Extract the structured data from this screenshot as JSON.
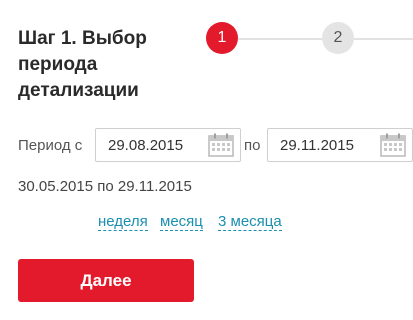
{
  "header": {
    "title": "Шаг 1. Выбор периода детализации"
  },
  "steps": [
    {
      "number": "1",
      "state": "active"
    },
    {
      "number": "2",
      "state": "inactive"
    }
  ],
  "period": {
    "label_from": "Период с",
    "date_from": "29.08.2015",
    "label_to": "по",
    "date_to": "29.11.2015"
  },
  "range_text": "30.05.2015 по 29.11.2015",
  "quick_links": [
    "неделя",
    "месяц",
    "3 месяца"
  ],
  "actions": {
    "next_label": "Далее"
  },
  "colors": {
    "accent": "#e21a2c",
    "link": "#1a8fb0",
    "step_inactive": "#e4e4e4"
  },
  "icons": {
    "calendar": "calendar-icon"
  }
}
